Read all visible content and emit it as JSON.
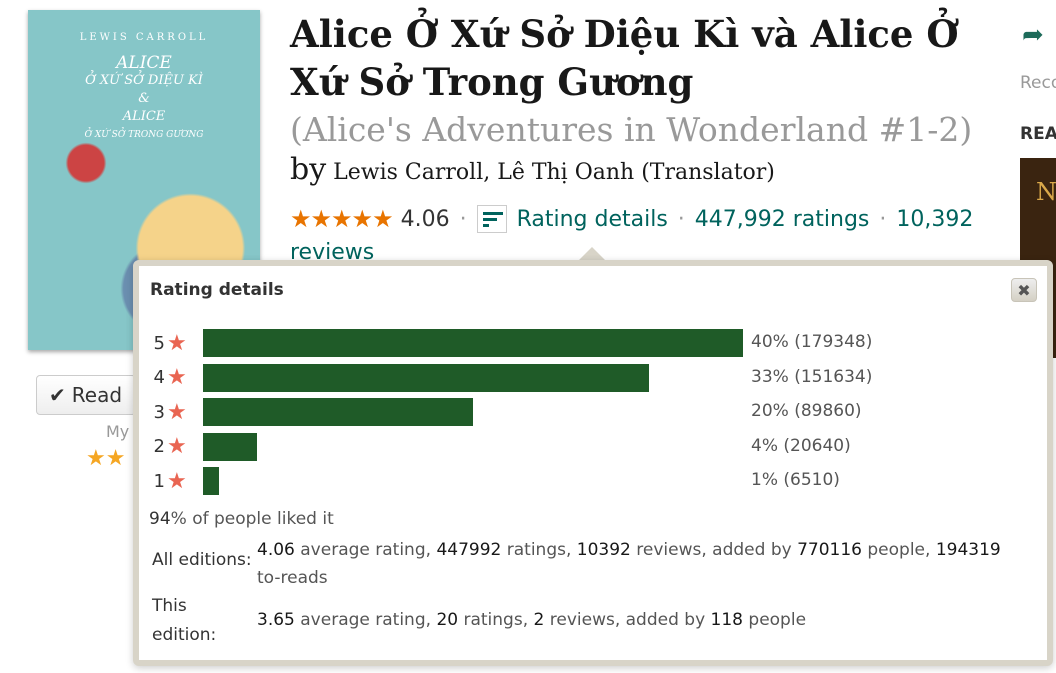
{
  "cover": {
    "author": "LEWIS CARROLL",
    "title_line1": "ALICE",
    "title_line2": "Ở XỨ SỞ DIỆU KÌ",
    "title_line3": "&",
    "title_line4": "ALICE",
    "title_line5": "Ở XỨ SỞ TRONG GƯƠNG"
  },
  "shelf": {
    "read_label": "Read",
    "check_icon": "checkmark-icon",
    "my_rating_label": "My",
    "my_rating_stars": "★★"
  },
  "book": {
    "title": "Alice Ở Xứ Sở Diệu Kì và Alice Ở Xứ Sở Trong Gương",
    "series": "(Alice's Adventures in Wonderland #1-2)",
    "by": "by",
    "authors": "Lewis Carroll, Lê Thị Oanh (Translator)",
    "stars": "★★★★★",
    "avg_rating": "4.06",
    "rating_details_link": "Rating details",
    "ratings_count": "447,992 ratings",
    "reviews_count": "10,392",
    "reviews_word": "reviews",
    "separator": "·"
  },
  "sidebar": {
    "share_icon": "share-arrow-icon",
    "reco_text": "Reco",
    "read_heading": "REA",
    "thumb_letter": "N"
  },
  "popup": {
    "title": "Rating details",
    "close_label": "✖",
    "star_glyph": "★",
    "rows": [
      {
        "stars": "5",
        "fraction": 0.4,
        "label": "40% (179348)"
      },
      {
        "stars": "4",
        "fraction": 0.33,
        "label": "33% (151634)"
      },
      {
        "stars": "3",
        "fraction": 0.2,
        "label": "20% (89860)"
      },
      {
        "stars": "2",
        "fraction": 0.04,
        "label": "4% (20640)"
      },
      {
        "stars": "1",
        "fraction": 0.01,
        "label": "1% (6510)"
      }
    ],
    "liked_pct": "94",
    "liked_text": "% of people liked it",
    "all_editions": {
      "label": "All editions:",
      "avg": "4.06",
      "avg_text": " average rating, ",
      "ratings": "447992",
      "ratings_text": " ratings, ",
      "reviews": "10392",
      "reviews_text": " reviews, added by ",
      "people": "770116",
      "people_text": " people, ",
      "toreads": "194319",
      "toreads_text": " to-reads"
    },
    "this_edition": {
      "label_line1": "This",
      "label_line2": "edition:",
      "avg": "3.65",
      "avg_text": " average rating, ",
      "ratings": "20",
      "ratings_text": " ratings, ",
      "reviews": "2",
      "reviews_text": " reviews, added by ",
      "people": "118",
      "people_text": " people"
    }
  },
  "colors": {
    "bar": "#1f5b28",
    "star_red": "#e96552",
    "link": "#00635d",
    "star_orange": "#e87400"
  }
}
